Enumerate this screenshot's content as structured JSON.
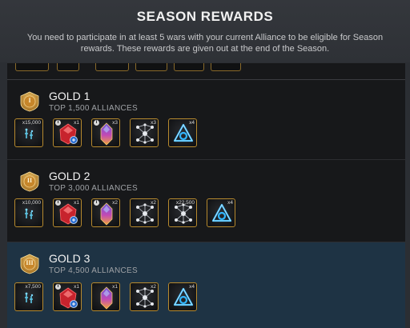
{
  "screen": {
    "title": "SEASON REWARDS",
    "description": "You need to participate in at least 5 wars with your current Alliance to be eligible for Season rewards. These rewards are given out at the end of the Season."
  },
  "tiers": [
    {
      "name": "GOLD 1",
      "requirement": "TOP 1,500 ALLIANCES",
      "badge_numeral": "I",
      "selected": false,
      "rewards": [
        {
          "icon": "gold-currency-icon",
          "quantity": "x15,000",
          "info": ""
        },
        {
          "icon": "red-crystal-icon",
          "quantity": "x1",
          "info": "i"
        },
        {
          "icon": "blue-crystal-icon",
          "quantity": "x3",
          "info": "i"
        },
        {
          "icon": "catalyst-network-icon",
          "quantity": "x3",
          "info": ""
        },
        {
          "icon": "blue-triangle-catalyst-icon",
          "quantity": "x4",
          "info": ""
        }
      ]
    },
    {
      "name": "GOLD 2",
      "requirement": "TOP 3,000 ALLIANCES",
      "badge_numeral": "II",
      "selected": false,
      "rewards": [
        {
          "icon": "gold-currency-icon",
          "quantity": "x10,000",
          "info": ""
        },
        {
          "icon": "red-crystal-icon",
          "quantity": "x1",
          "info": "i"
        },
        {
          "icon": "blue-crystal-icon",
          "quantity": "x2",
          "info": "i"
        },
        {
          "icon": "catalyst-network-icon",
          "quantity": "x2",
          "info": ""
        },
        {
          "icon": "catalyst-network-icon",
          "quantity": "x22,500",
          "info": ""
        },
        {
          "icon": "blue-triangle-catalyst-icon",
          "quantity": "x4",
          "info": ""
        }
      ]
    },
    {
      "name": "GOLD 3",
      "requirement": "TOP 4,500 ALLIANCES",
      "badge_numeral": "III",
      "selected": true,
      "rewards": [
        {
          "icon": "gold-currency-icon",
          "quantity": "x7,500",
          "info": ""
        },
        {
          "icon": "red-crystal-icon",
          "quantity": "x1",
          "info": "i"
        },
        {
          "icon": "blue-crystal-icon",
          "quantity": "x1",
          "info": ""
        },
        {
          "icon": "catalyst-network-icon",
          "quantity": "x2",
          "info": ""
        },
        {
          "icon": "blue-triangle-catalyst-icon",
          "quantity": "x4",
          "info": ""
        }
      ]
    }
  ],
  "colors": {
    "item_border": "#b78a2e",
    "selected_row": "#1e3344",
    "badge_gold": "#d9a43c"
  }
}
